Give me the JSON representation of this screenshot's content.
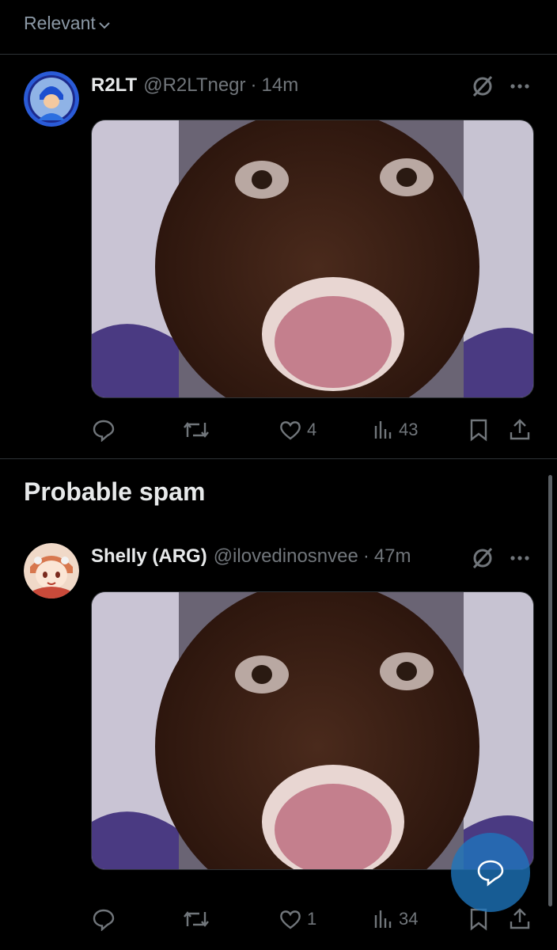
{
  "sort": {
    "label": "Relevant"
  },
  "tweets": [
    {
      "display_name": "R2LT",
      "handle": "@R2LTnegr",
      "separator": "·",
      "time": "14m",
      "avatar_icon": "mega-man-avatar",
      "media_icon": "shocked-face-image",
      "replies": "",
      "retweets": "",
      "likes": "4",
      "views": "43"
    },
    {
      "display_name": "Shelly (ARG)",
      "handle": "@ilovedinosnvee",
      "separator": "·",
      "time": "47m",
      "avatar_icon": "anime-girl-avatar",
      "media_icon": "shocked-face-image",
      "replies": "",
      "retweets": "",
      "likes": "1",
      "views": "34"
    }
  ],
  "section": {
    "title": "Probable spam"
  },
  "colors": {
    "background": "#000000",
    "text": "#e7e9ea",
    "muted": "#71767b",
    "divider": "#2f3336",
    "fab": "#1d76be"
  }
}
